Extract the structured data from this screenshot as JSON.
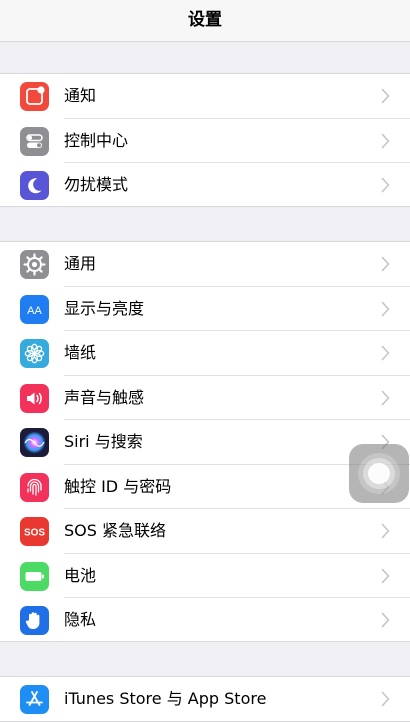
{
  "nav": {
    "title": "设置"
  },
  "groups": [
    {
      "rows": [
        {
          "label": "通知",
          "icon": "notifications-icon",
          "color": "#f14a3c"
        },
        {
          "label": "控制中心",
          "icon": "control-center-icon",
          "color": "#8e8e93"
        },
        {
          "label": "勿扰模式",
          "icon": "moon-icon",
          "color": "#5856d6"
        }
      ]
    },
    {
      "rows": [
        {
          "label": "通用",
          "icon": "gear-icon",
          "color": "#8e8e93"
        },
        {
          "label": "显示与亮度",
          "icon": "display-text-size-icon",
          "color": "#1f7cf1",
          "icon_text": "AA"
        },
        {
          "label": "墙纸",
          "icon": "wallpaper-flower-icon",
          "color": "#35aadc"
        },
        {
          "label": "声音与触感",
          "icon": "speaker-icon",
          "color": "#f2325a"
        },
        {
          "label": "Siri 与搜索",
          "icon": "siri-icon",
          "color": "#1c1c3a"
        },
        {
          "label": "触控 ID 与密码",
          "icon": "fingerprint-icon",
          "color": "#f2325a"
        },
        {
          "label": "SOS 紧急联络",
          "icon": "sos-icon",
          "color": "#e8382f",
          "icon_text": "SOS"
        },
        {
          "label": "电池",
          "icon": "battery-icon",
          "color": "#4cd964"
        },
        {
          "label": "隐私",
          "icon": "hand-icon",
          "color": "#1f6fe6"
        }
      ]
    },
    {
      "rows": [
        {
          "label": "iTunes Store 与 App Store",
          "icon": "app-store-icon",
          "color": "#1e8ef5"
        }
      ]
    }
  ],
  "assistive_touch": {
    "icon": "assistive-touch-icon"
  }
}
